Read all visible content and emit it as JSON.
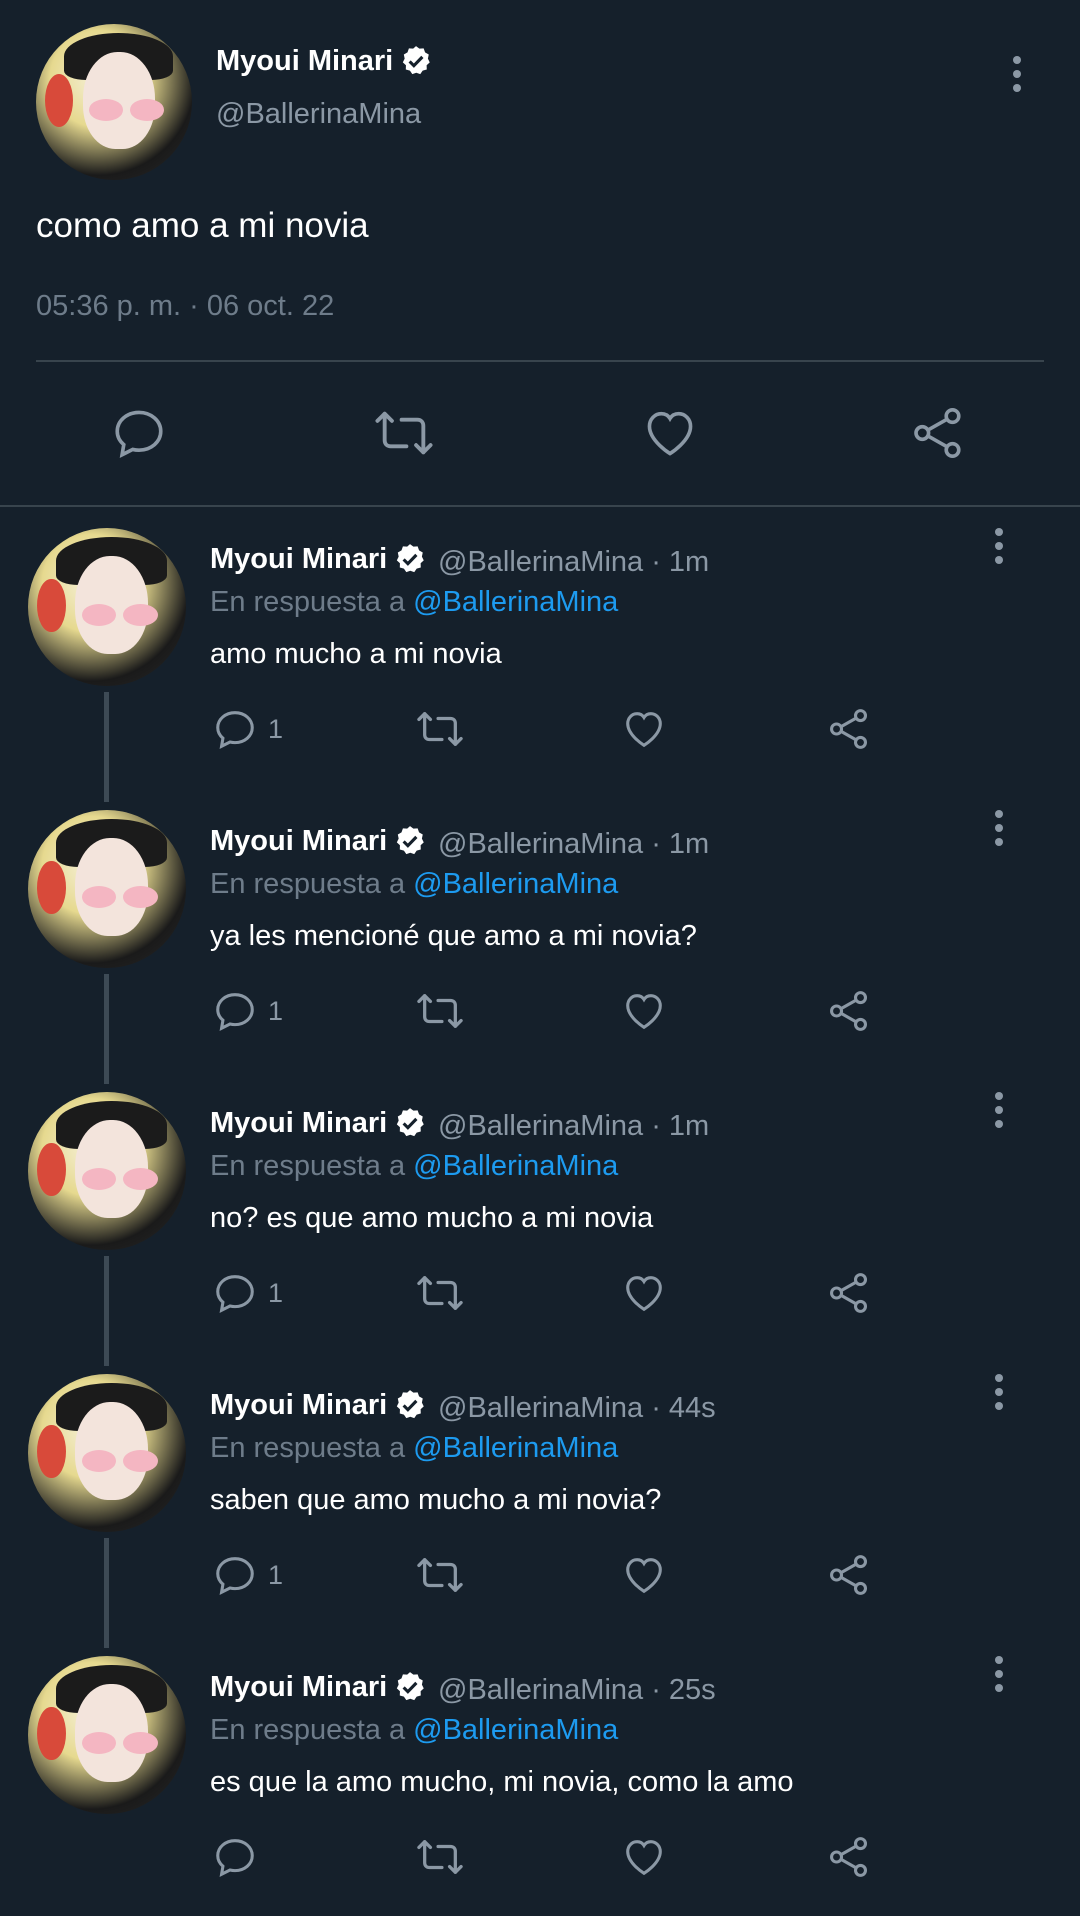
{
  "main_tweet": {
    "name": "Myoui Minari",
    "handle": "@BallerinaMina",
    "text": "como amo a mi novia",
    "timestamp": "05:36 p. m. · 06 oct. 22"
  },
  "replies": [
    {
      "name": "Myoui Minari",
      "handle": "@BallerinaMina · 1m",
      "replying_prefix": "En respuesta a ",
      "replying_mention": "@BallerinaMina",
      "text": "amo mucho a mi novia",
      "reply_count": "1"
    },
    {
      "name": "Myoui Minari",
      "handle": "@BallerinaMina · 1m",
      "replying_prefix": "En respuesta a ",
      "replying_mention": "@BallerinaMina",
      "text": "ya les mencioné que amo a mi novia?",
      "reply_count": "1"
    },
    {
      "name": "Myoui Minari",
      "handle": "@BallerinaMina · 1m",
      "replying_prefix": "En respuesta a ",
      "replying_mention": "@BallerinaMina",
      "text": "no? es que amo mucho a mi novia",
      "reply_count": "1"
    },
    {
      "name": "Myoui Minari",
      "handle": "@BallerinaMina · 44s",
      "replying_prefix": "En respuesta a ",
      "replying_mention": "@BallerinaMina",
      "text": "saben que amo mucho a mi novia?",
      "reply_count": "1"
    },
    {
      "name": "Myoui Minari",
      "handle": "@BallerinaMina · 25s",
      "replying_prefix": "En respuesta a ",
      "replying_mention": "@BallerinaMina",
      "text": "es que la amo mucho, mi novia, como la amo",
      "reply_count": ""
    }
  ],
  "icons": [
    "verified-badge-icon",
    "more-options-icon",
    "reply-icon",
    "retweet-icon",
    "like-icon",
    "share-icon"
  ],
  "colors": {
    "background": "#15202b",
    "mention": "#1d9bf0",
    "secondary_text": "#8b98a5",
    "divider": "#38444d"
  }
}
